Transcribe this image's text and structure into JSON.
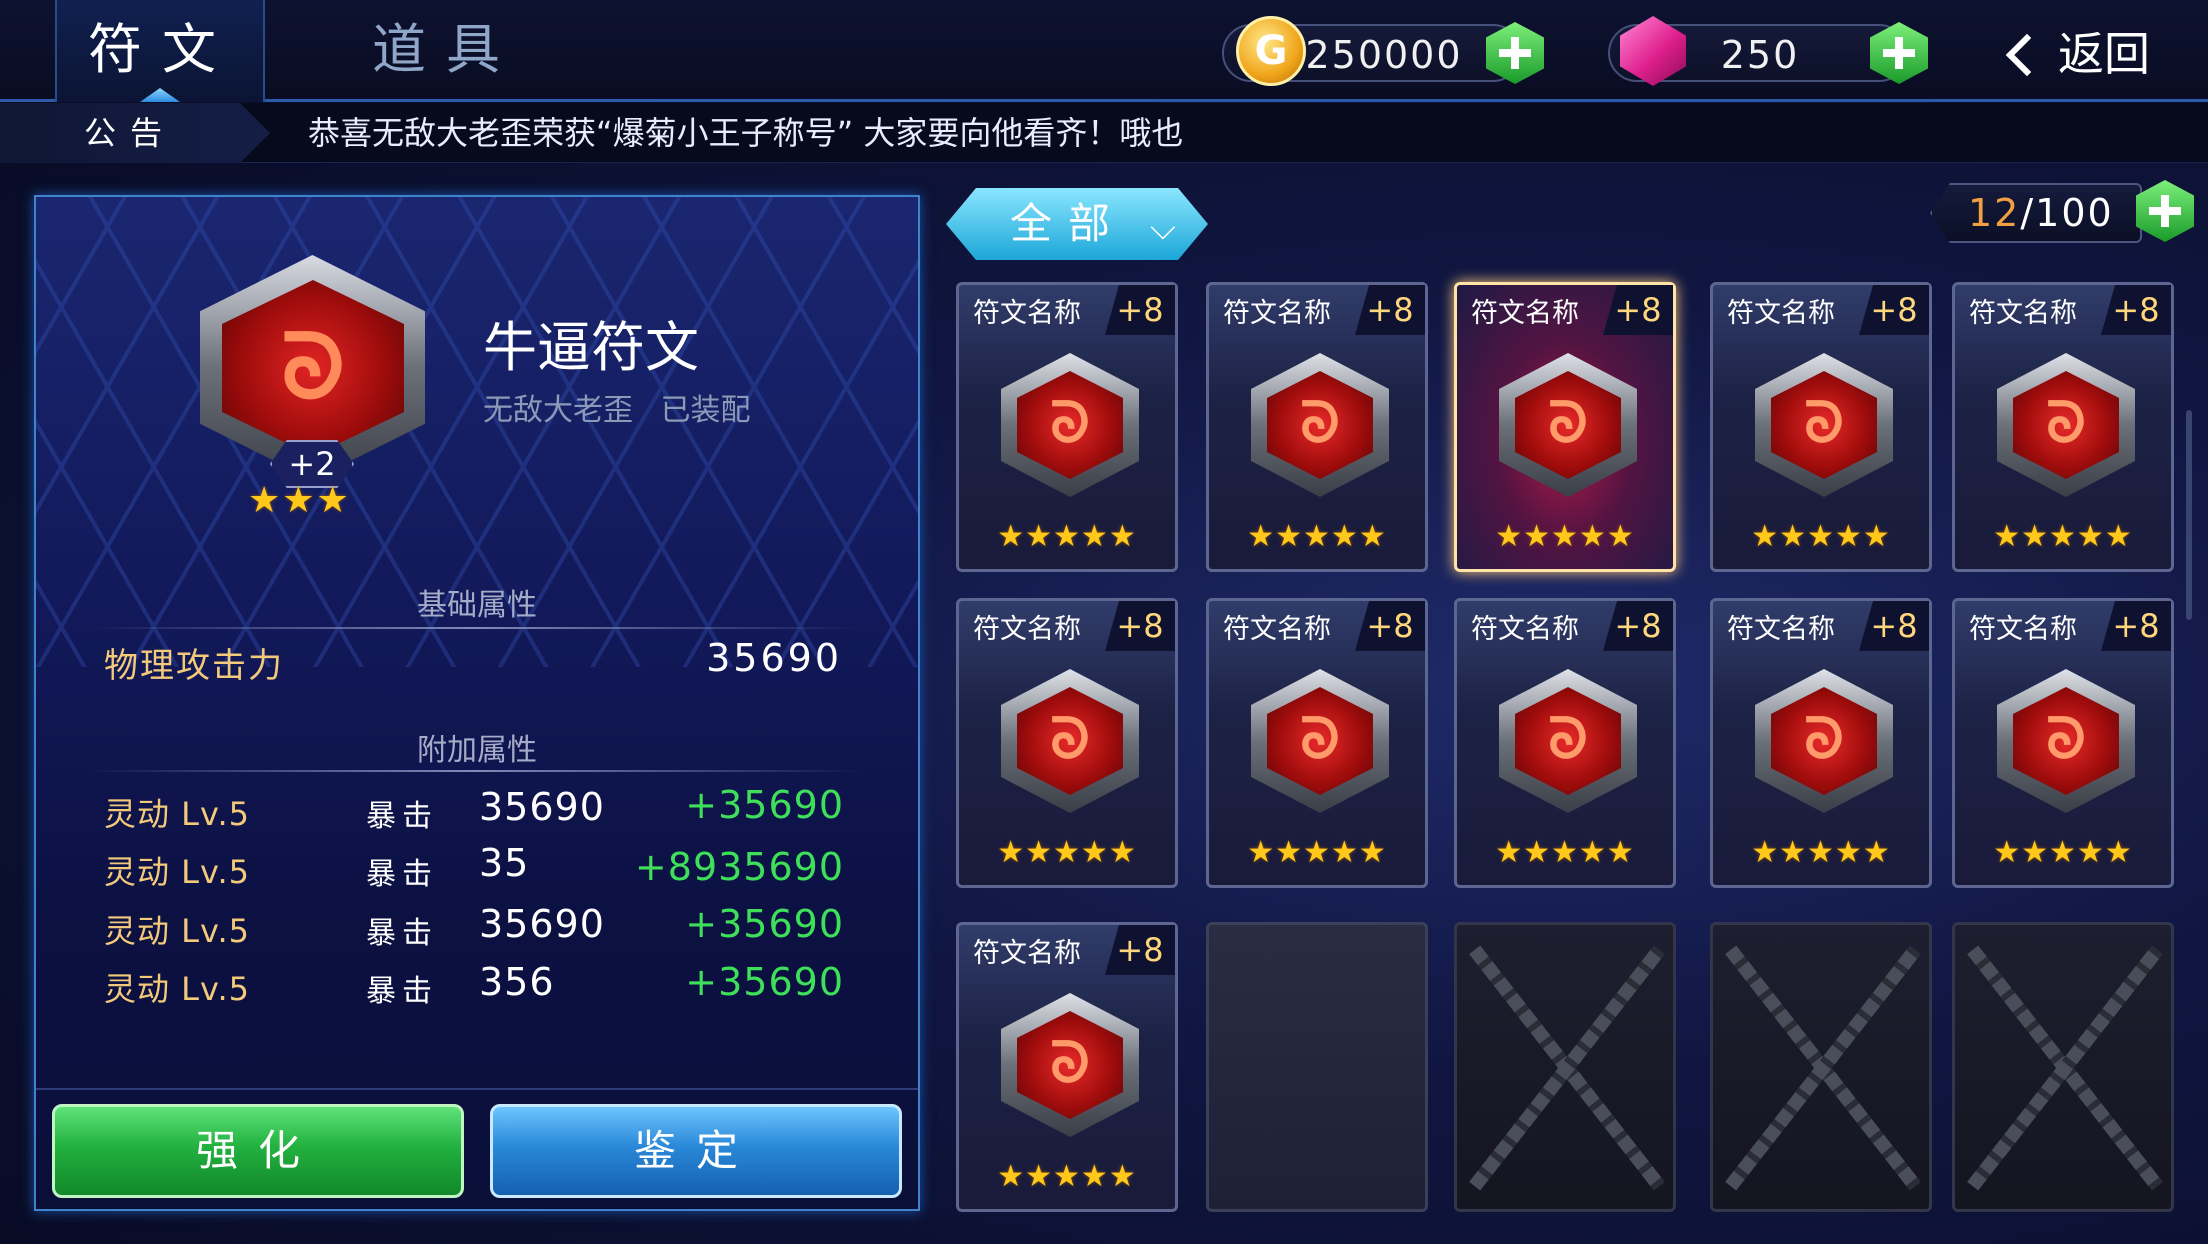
{
  "tabs": {
    "rune": "符文",
    "item": "道具"
  },
  "currency": {
    "gold": "250000",
    "gem": "250",
    "gold_icon_letter": "G"
  },
  "back_label": "返回",
  "notice": {
    "label": "公告",
    "text": "恭喜无敌大老歪荣获“爆菊小王子称号”  大家要向他看齐！哦也"
  },
  "detail": {
    "name": "牛逼符文",
    "owner": "无敌大老歪",
    "status": "已装配",
    "level": "+2",
    "stars": "★★★",
    "base_title": "基础属性",
    "base_attr": {
      "name": "物理攻击力",
      "value": "35690"
    },
    "extra_title": "附加属性",
    "extra_attrs": [
      {
        "name": "灵动 Lv.5",
        "type": "暴击",
        "value": "35690",
        "add": "+35690"
      },
      {
        "name": "灵动 Lv.5",
        "type": "暴击",
        "value": "35",
        "add": "+8935690"
      },
      {
        "name": "灵动 Lv.5",
        "type": "暴击",
        "value": "35690",
        "add": "+35690"
      },
      {
        "name": "灵动 Lv.5",
        "type": "暴击",
        "value": "356",
        "add": "+35690"
      }
    ],
    "enhance_label": "强化",
    "identify_label": "鉴定"
  },
  "filter_label": "全部",
  "capacity": {
    "current": "12",
    "max": "/100"
  },
  "runes": [
    {
      "name": "符文名称",
      "level": "+8",
      "stars": "★★★★★",
      "selected": false
    },
    {
      "name": "符文名称",
      "level": "+8",
      "stars": "★★★★★",
      "selected": false
    },
    {
      "name": "符文名称",
      "level": "+8",
      "stars": "★★★★★",
      "selected": true
    },
    {
      "name": "符文名称",
      "level": "+8",
      "stars": "★★★★★",
      "selected": false
    },
    {
      "name": "符文名称",
      "level": "+8",
      "stars": "★★★★★",
      "selected": false
    },
    {
      "name": "符文名称",
      "level": "+8",
      "stars": "★★★★★",
      "selected": false
    },
    {
      "name": "符文名称",
      "level": "+8",
      "stars": "★★★★★",
      "selected": false
    },
    {
      "name": "符文名称",
      "level": "+8",
      "stars": "★★★★★",
      "selected": false
    },
    {
      "name": "符文名称",
      "level": "+8",
      "stars": "★★★★★",
      "selected": false
    },
    {
      "name": "符文名称",
      "level": "+8",
      "stars": "★★★★★",
      "selected": false
    },
    {
      "name": "符文名称",
      "level": "+8",
      "stars": "★★★★★",
      "selected": false
    }
  ],
  "empty_slots": 1,
  "locked_slots": 3,
  "colors": {
    "accent": "#3f83cc",
    "gold_text": "#f3c97a",
    "bonus_green": "#3ee05a",
    "selected_border": "#ffe4a8"
  },
  "icons": {
    "rune": "red-hexagon-rune-icon",
    "gold": "gold-coin-icon",
    "gem": "pink-gem-icon",
    "add": "green-plus-icon",
    "back": "back-arrow-icon"
  }
}
